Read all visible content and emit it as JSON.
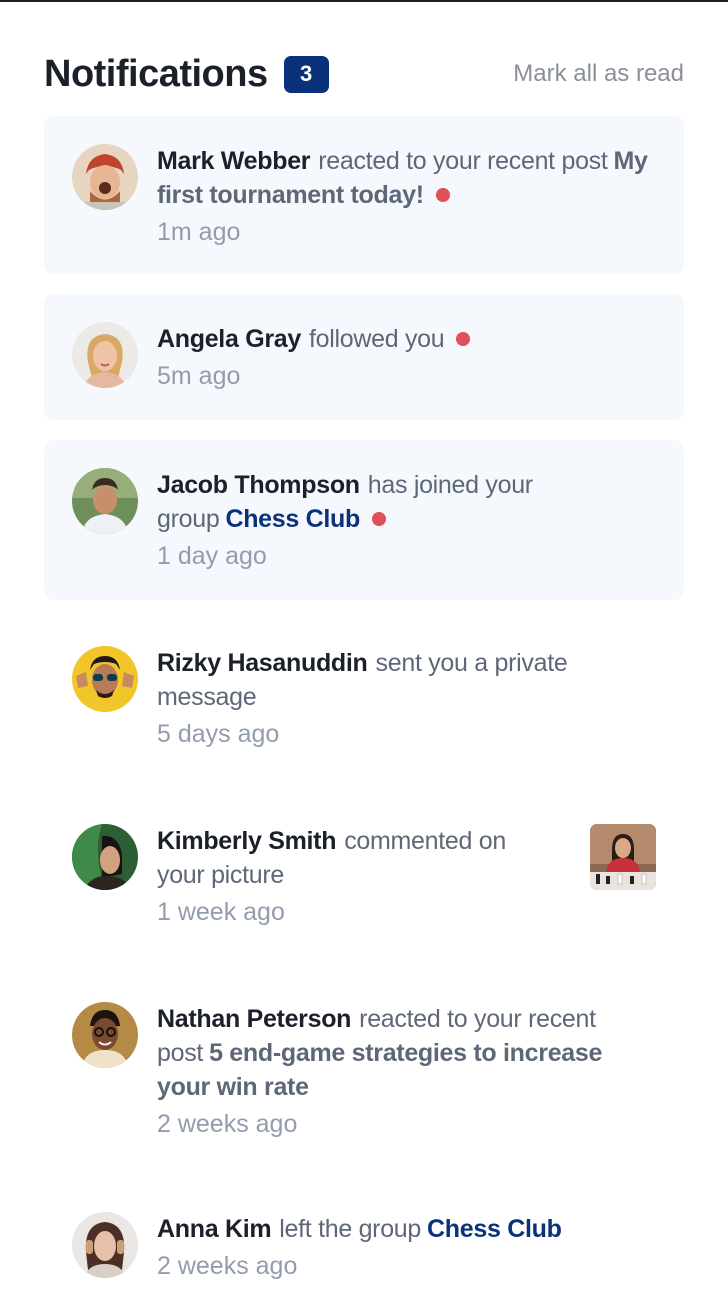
{
  "header": {
    "title": "Notifications",
    "unread_count": "3",
    "mark_all_label": "Mark all as read"
  },
  "notifications": [
    {
      "name": "Mark Webber",
      "action": "reacted to your recent post",
      "post": "My first tournament today!",
      "time": "1m ago",
      "unread": true,
      "avatar": "avatar-mark-webber"
    },
    {
      "name": "Angela Gray",
      "action": "followed you",
      "time": "5m ago",
      "unread": true,
      "avatar": "avatar-angela-gray"
    },
    {
      "name": "Jacob Thompson",
      "action": "has joined your group",
      "group": "Chess Club",
      "time": "1 day ago",
      "unread": true,
      "avatar": "avatar-jacob-thompson"
    },
    {
      "name": "Rizky Hasanuddin",
      "action": "sent you a private message",
      "time": "5 days ago",
      "unread": false,
      "avatar": "avatar-rizky-hasanuddin"
    },
    {
      "name": "Kimberly Smith",
      "action": "commented on your picture",
      "time": "1 week ago",
      "unread": false,
      "avatar": "avatar-kimberly-smith",
      "thumbnail": "chess-picture-thumbnail"
    },
    {
      "name": "Nathan Peterson",
      "action": "reacted to your recent post",
      "post": "5 end-game strategies to increase your win rate",
      "time": "2 weeks ago",
      "unread": false,
      "avatar": "avatar-nathan-peterson"
    },
    {
      "name": "Anna Kim",
      "action": "left the group",
      "group": "Chess Club",
      "time": "2 weeks ago",
      "unread": false,
      "avatar": "avatar-anna-kim"
    }
  ],
  "colors": {
    "accent": "#0a327b",
    "unread_dot": "#e0505b",
    "unread_bg": "#f5f8fd",
    "text_dark": "#1c202b",
    "text_muted": "#939cad"
  }
}
